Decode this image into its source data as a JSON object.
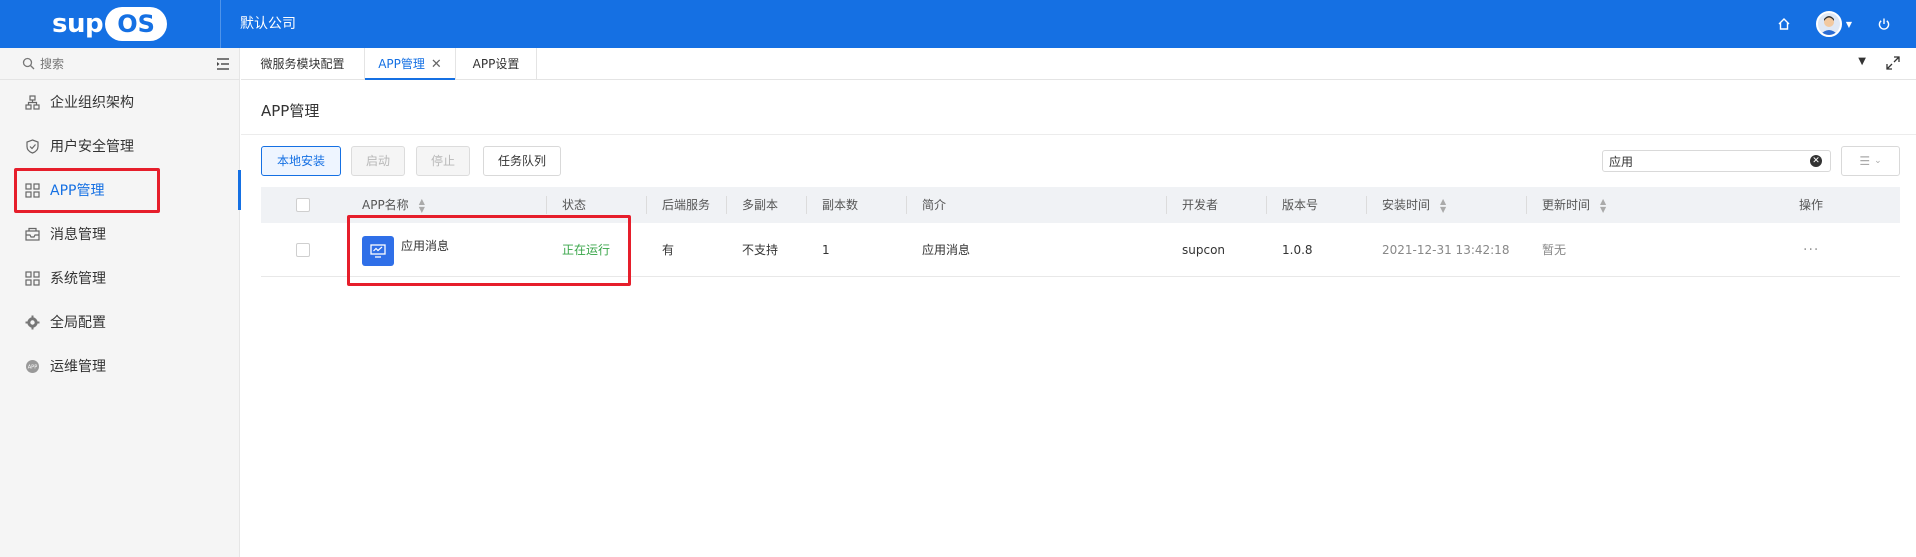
{
  "brand": {
    "logo_prefix": "sup",
    "logo_suffix": "OS"
  },
  "header": {
    "company": "默认公司"
  },
  "sidebar": {
    "search_placeholder": "搜索",
    "items": [
      {
        "label": "企业组织架构",
        "icon": "org-chart-icon"
      },
      {
        "label": "用户安全管理",
        "icon": "shield-icon"
      },
      {
        "label": "APP管理",
        "icon": "grid-icon",
        "active": true
      },
      {
        "label": "消息管理",
        "icon": "inbox-icon"
      },
      {
        "label": "系统管理",
        "icon": "grid-icon"
      },
      {
        "label": "全局配置",
        "icon": "gear-icon"
      },
      {
        "label": "运维管理",
        "icon": "app-badge-icon"
      }
    ]
  },
  "tabs": [
    {
      "label": "微服务模块配置"
    },
    {
      "label": "APP管理",
      "active": true
    },
    {
      "label": "APP设置"
    }
  ],
  "page": {
    "title": "APP管理"
  },
  "toolbar": {
    "install_label": "本地安装",
    "start_label": "启动",
    "stop_label": "停止",
    "queue_label": "任务队列",
    "filter_value": "应用"
  },
  "table": {
    "headers": [
      "APP名称",
      "状态",
      "后端服务",
      "多副本",
      "副本数",
      "简介",
      "开发者",
      "版本号",
      "安装时间",
      "更新时间",
      "操作"
    ],
    "rows": [
      {
        "name": "应用消息",
        "status": "正在运行",
        "backend": "有",
        "multi_replica": "不支持",
        "replicas": "1",
        "description": "应用消息",
        "developer": "supcon",
        "version": "1.0.8",
        "installed": "2021-12-31 13:42:18",
        "updated": "暂无",
        "actions": "···"
      }
    ]
  },
  "colors": {
    "brand_blue": "#1570e3",
    "highlight_red": "#e61e2b",
    "running_green": "#3aa64a"
  }
}
